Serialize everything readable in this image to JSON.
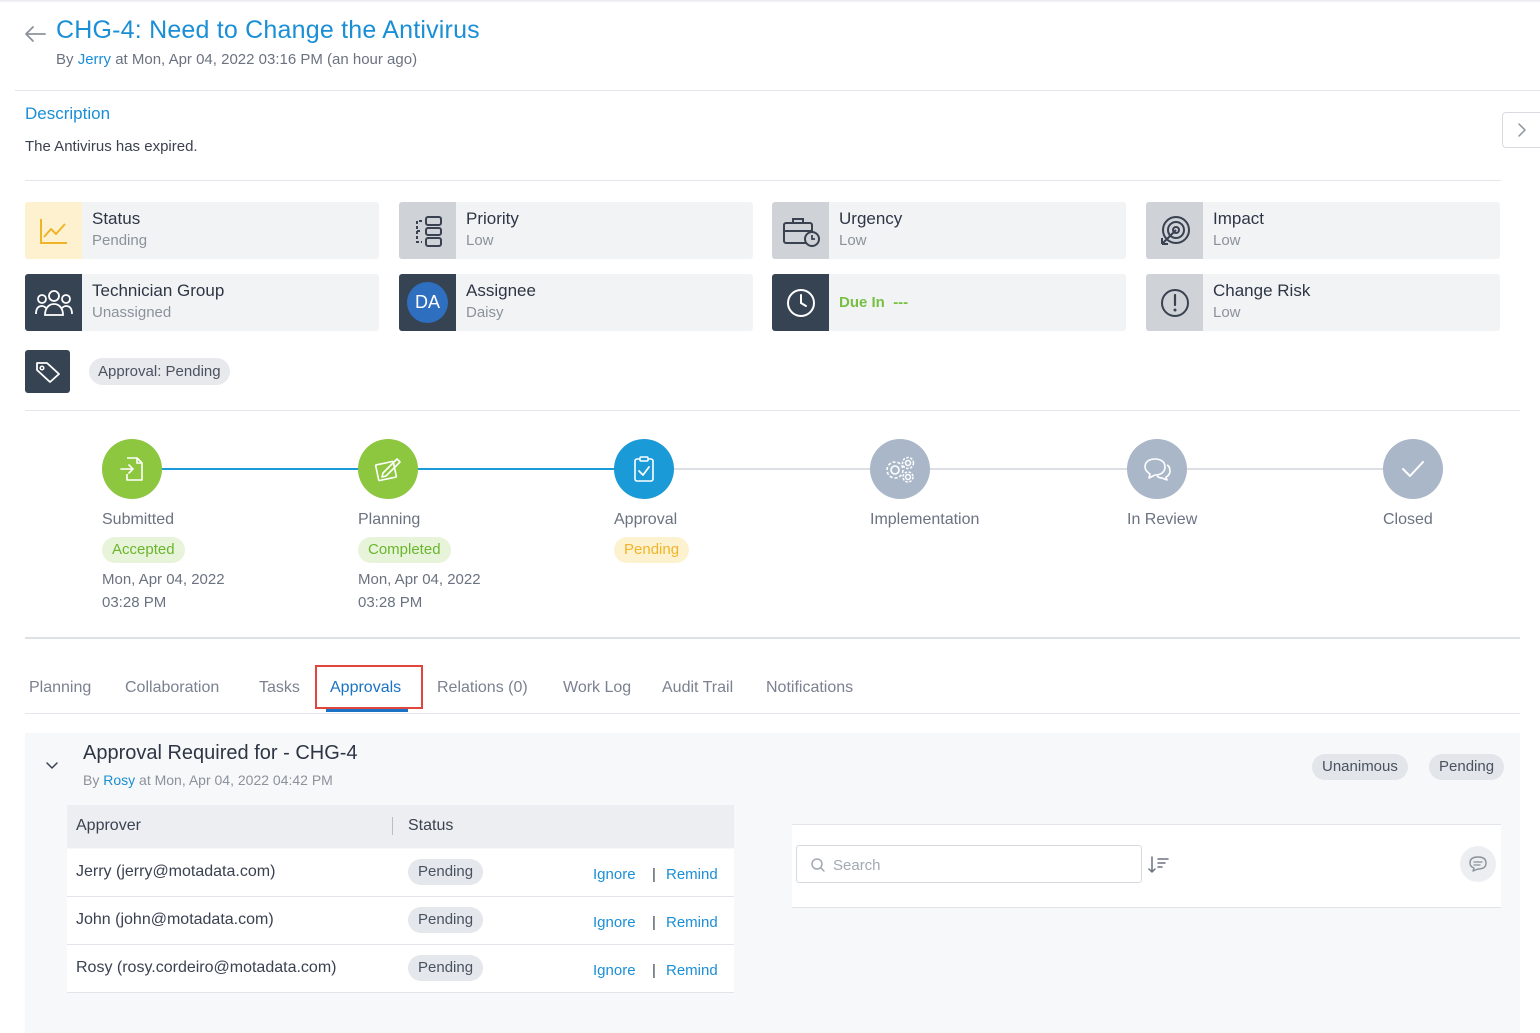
{
  "header": {
    "title": "CHG-4: Need to Change the Antivirus",
    "by_prefix": "By",
    "author": "Jerry",
    "timestamp": "at Mon, Apr 04, 2022 03:16 PM (an hour ago)"
  },
  "description": {
    "title": "Description",
    "text": "The Antivirus has expired."
  },
  "cards": {
    "status": {
      "label": "Status",
      "value": "Pending",
      "icon": "trend-chart-icon"
    },
    "priority": {
      "label": "Priority",
      "value": "Low",
      "icon": "priority-flow-icon"
    },
    "urgency": {
      "label": "Urgency",
      "value": "Low",
      "icon": "briefcase-clock-icon"
    },
    "impact": {
      "label": "Impact",
      "value": "Low",
      "icon": "target-icon"
    },
    "technician_group": {
      "label": "Technician Group",
      "value": "Unassigned",
      "icon": "users-icon"
    },
    "assignee": {
      "label": "Assignee",
      "value": "Daisy",
      "initials": "DA"
    },
    "due": {
      "label": "Due In",
      "value": "---",
      "icon": "clock-icon"
    },
    "change_risk": {
      "label": "Change Risk",
      "value": "Low",
      "icon": "exclamation-icon"
    }
  },
  "tags": {
    "items": [
      "Approval: Pending"
    ]
  },
  "stepper": {
    "steps": [
      {
        "name": "Submitted",
        "badge": "Accepted",
        "date": "Mon, Apr 04, 2022",
        "time": "03:28 PM"
      },
      {
        "name": "Planning",
        "badge": "Completed",
        "date": "Mon, Apr 04, 2022",
        "time": "03:28 PM"
      },
      {
        "name": "Approval",
        "badge": "Pending"
      },
      {
        "name": "Implementation"
      },
      {
        "name": "In Review"
      },
      {
        "name": "Closed"
      }
    ]
  },
  "tabs": [
    "Planning",
    "Collaboration",
    "Tasks",
    "Approvals",
    "Relations (0)",
    "Work Log",
    "Audit Trail",
    "Notifications"
  ],
  "active_tab": "Approvals",
  "approval": {
    "title": "Approval Required for - CHG-4",
    "by_prefix": "By",
    "author": "Rosy",
    "timestamp": "at Mon, Apr 04, 2022 04:42 PM",
    "type": "Unanimous",
    "status": "Pending",
    "columns": {
      "approver": "Approver",
      "status": "Status"
    },
    "rows": [
      {
        "approver": "Jerry (jerry@motadata.com)",
        "status": "Pending",
        "ignore": "Ignore",
        "sep": "|",
        "remind": "Remind"
      },
      {
        "approver": "John (john@motadata.com)",
        "status": "Pending",
        "ignore": "Ignore",
        "sep": "|",
        "remind": "Remind"
      },
      {
        "approver": "Rosy (rosy.cordeiro@motadata.com)",
        "status": "Pending",
        "ignore": "Ignore",
        "sep": "|",
        "remind": "Remind"
      }
    ],
    "search_placeholder": "Search"
  },
  "colors": {
    "accent": "#1a8fd6",
    "step_done": "#8dc63f",
    "step_active": "#1a9ad6",
    "step_todo": "#a9b7c9",
    "highlight": "#e0453e"
  }
}
